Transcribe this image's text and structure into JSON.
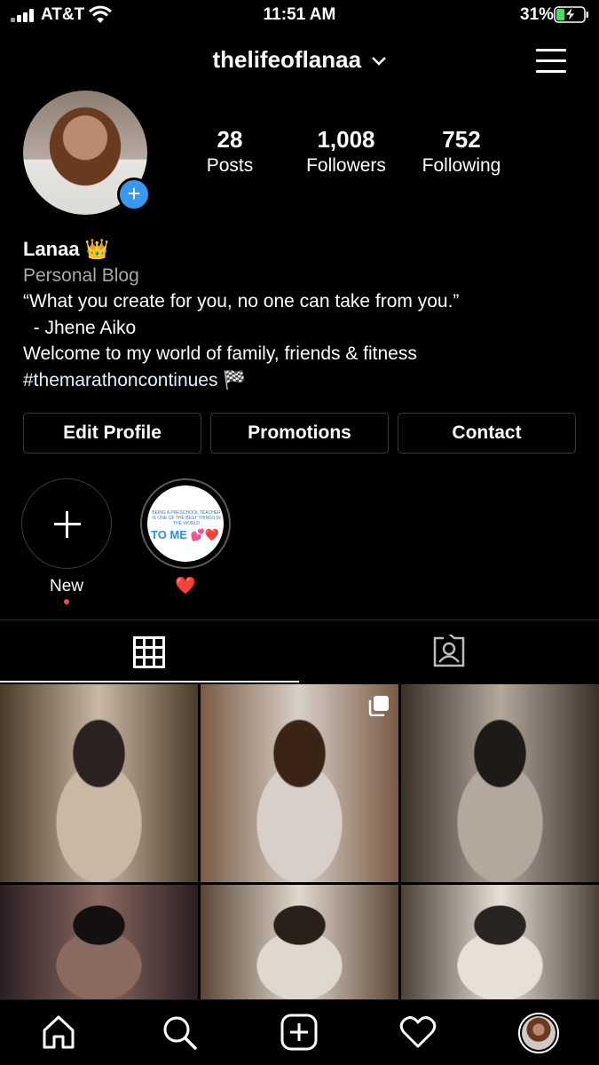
{
  "status_bar": {
    "carrier": "AT&T",
    "time": "11:51 AM",
    "battery_percent": "31%",
    "battery_level": 0.31,
    "icons": [
      "signal-icon",
      "wifi-icon",
      "battery-charging-icon"
    ]
  },
  "header": {
    "username": "thelifeoflanaa",
    "icons": [
      "chevron-down-icon",
      "menu-icon"
    ]
  },
  "profile": {
    "stats": [
      {
        "value": "28",
        "label": "Posts"
      },
      {
        "value": "1,008",
        "label": "Followers"
      },
      {
        "value": "752",
        "label": "Following"
      }
    ],
    "add_story_glyph": "+",
    "name": "Lanaa 👑",
    "category": "Personal Blog",
    "bio_lines": [
      "“What you create for you, no one can take from you.”",
      "  - Jhene Aiko",
      "Welcome to my world of family, friends & fitness"
    ],
    "hashtag_line": "#themarathoncontinues 🏁"
  },
  "buttons": {
    "edit_profile": "Edit Profile",
    "promotions": "Promotions",
    "contact": "Contact"
  },
  "highlights": [
    {
      "label": "New",
      "icon": "plus-icon"
    },
    {
      "label": "❤️",
      "story_text_small": "BEING A PRESCHOOL TEACHER IS ONE OF THE BEST THINGS IN THE WORLD",
      "story_text_large": "TO ME 💕❤️"
    }
  ],
  "tabs": [
    {
      "icon": "grid-icon",
      "active": true
    },
    {
      "icon": "tagged-icon",
      "active": false
    }
  ],
  "grid_posts": [
    {
      "colors": [
        "#4a3a2a",
        "#c9b8a3",
        "#2a2220"
      ]
    },
    {
      "colors": [
        "#7a5a44",
        "#d8d0c8",
        "#3a2418"
      ],
      "multiple": true
    },
    {
      "colors": [
        "#3a3028",
        "#b4a89c",
        "#1e1a18"
      ]
    },
    {
      "colors": [
        "#2a1e22",
        "#8a6a60",
        "#150f12"
      ]
    },
    {
      "colors": [
        "#5a4636",
        "#e0d8cc",
        "#2a201a"
      ]
    },
    {
      "colors": [
        "#4a4038",
        "#e6e0d6",
        "#2a2420"
      ]
    }
  ],
  "bottom_nav": [
    {
      "icon": "home-icon"
    },
    {
      "icon": "search-icon"
    },
    {
      "icon": "add-post-icon"
    },
    {
      "icon": "heart-icon"
    },
    {
      "icon": "profile-avatar-icon"
    }
  ],
  "colors": {
    "background": "#000000",
    "accent_blue": "#3897f0",
    "notification_red": "#ed4956",
    "battery_green": "#4cd964"
  }
}
